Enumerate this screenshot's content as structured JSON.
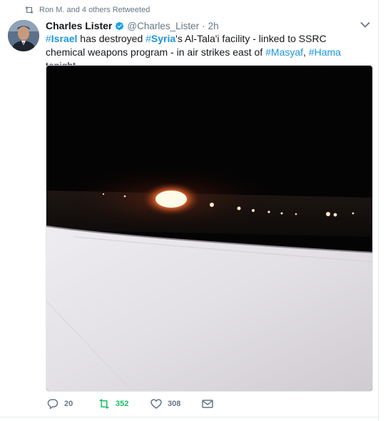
{
  "context": {
    "icon": "retweet-icon",
    "text": "Ron M. and 4 others Retweeted"
  },
  "tweet": {
    "author_name": "Charles Lister",
    "verified": true,
    "handle": "@Charles_Lister",
    "separator": "·",
    "time": "2h",
    "text_parts": [
      {
        "hash": "#",
        "tag": "Israel"
      },
      {
        "plain": " has destroyed "
      },
      {
        "hash": "#",
        "tag": "Syria"
      },
      {
        "plain": "'s Al-Tala'i facility - linked to SSRC chemical weapons program - in air strikes east of "
      },
      {
        "hash": "#",
        "tag": "Masyaf"
      },
      {
        "plain": ", "
      },
      {
        "hash": "#",
        "tag": "Hama"
      },
      {
        "plain": " tonight."
      }
    ],
    "media_icon": "night-photo-airplane-wing-explosion",
    "actions": {
      "reply_count": "20",
      "retweet_count": "352",
      "like_count": "308"
    }
  },
  "colors": {
    "link": "#1b95e0",
    "retweeted_green": "#17bf63",
    "muted": "#657786",
    "verified_blue": "#1da1f2"
  }
}
